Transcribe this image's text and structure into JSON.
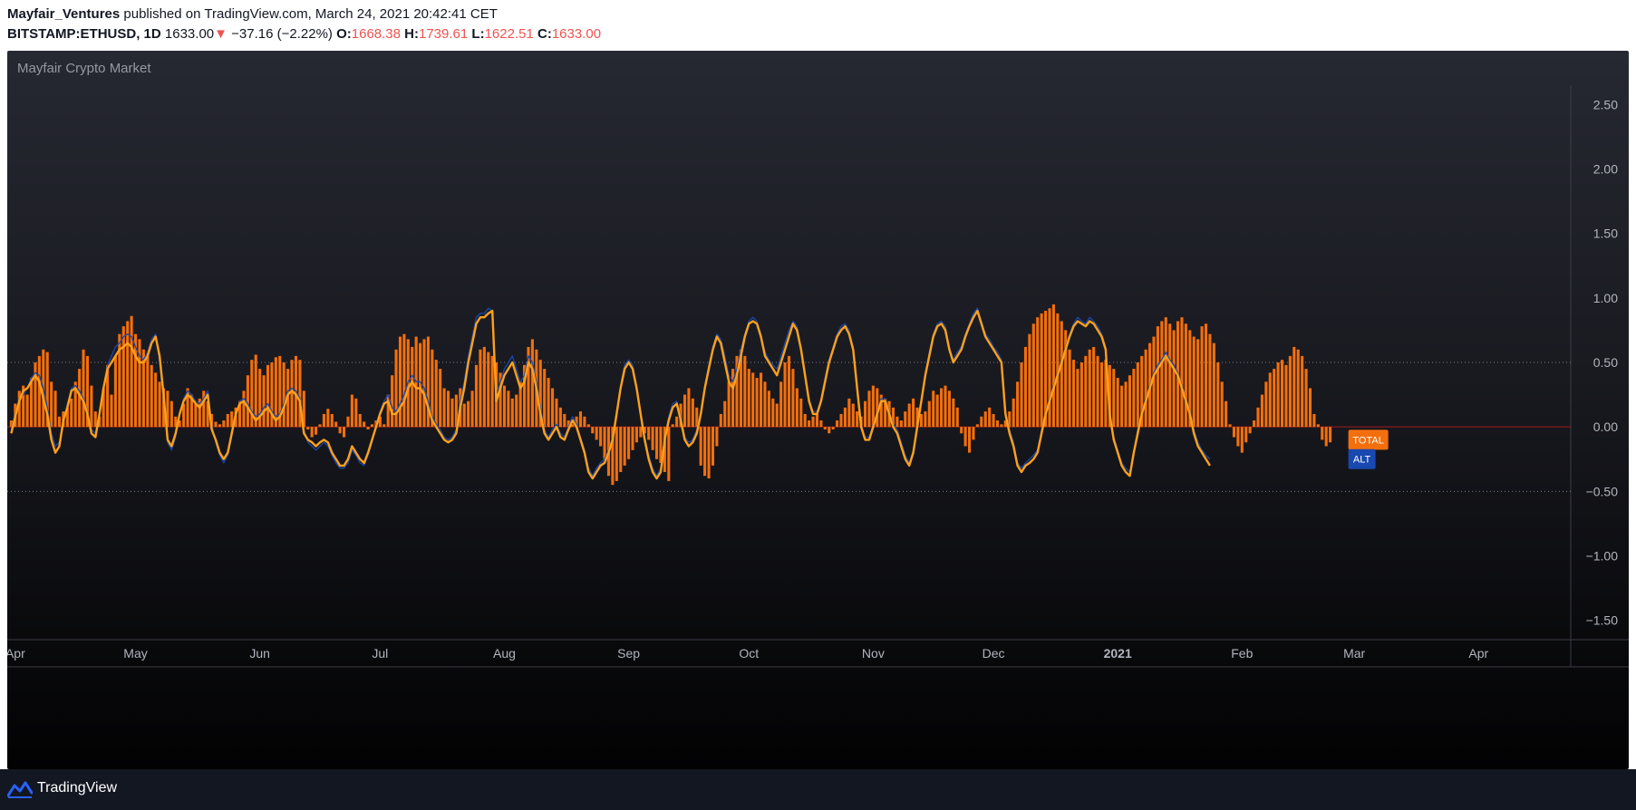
{
  "header": {
    "author": "Mayfair_Ventures",
    "published_text": " published on TradingView.com, March 24, 2021 20:42:41 CET",
    "symbol": "BITSTAMP:ETHUSD",
    "interval": ", 1D",
    "price": "1633.00",
    "change_arrow": "▼",
    "change": "−37.16 (−2.22%)",
    "open_label": "O:",
    "open": "1668.38",
    "high_label": "H:",
    "high": "1739.61",
    "low_label": "L:",
    "low": "1622.51",
    "close_label": "C:",
    "close": "1633.00"
  },
  "footer": {
    "brand": "TradingView"
  },
  "colors": {
    "histogram": "#f46f0c",
    "orange_line": "#ffa11a",
    "blue_line": "#1848b0",
    "gray_line": "#9598a1",
    "zero_line": "#a31c1c",
    "text_red": "#ef5350"
  },
  "chart_data": {
    "type": "bar",
    "title": "Mayfair Crypto Market",
    "y_ticks": [
      "2.50",
      "2.00",
      "1.50",
      "1.00",
      "0.50",
      "0.00",
      "−0.50",
      "−1.00",
      "−1.50"
    ],
    "ylim": [
      -1.65,
      2.65
    ],
    "reference_lines": [
      0.5,
      -0.5
    ],
    "x_ticks": [
      {
        "label": "Apr",
        "date": "2020-04-01"
      },
      {
        "label": "May",
        "date": "2020-05-01"
      },
      {
        "label": "Jun",
        "date": "2020-06-01"
      },
      {
        "label": "Jul",
        "date": "2020-07-01"
      },
      {
        "label": "Aug",
        "date": "2020-08-01"
      },
      {
        "label": "Sep",
        "date": "2020-09-01"
      },
      {
        "label": "Oct",
        "date": "2020-10-01"
      },
      {
        "label": "Nov",
        "date": "2020-11-01"
      },
      {
        "label": "Dec",
        "date": "2020-12-01"
      },
      {
        "label": "2021",
        "date": "2021-01-01",
        "bold": true
      },
      {
        "label": "Feb",
        "date": "2021-02-01"
      },
      {
        "label": "Mar",
        "date": "2021-03-01"
      },
      {
        "label": "Apr",
        "date": "2021-04-01"
      }
    ],
    "xlim": [
      "2020-03-30",
      "2021-04-24"
    ],
    "series": [
      {
        "type": "histogram",
        "start_date": "2020-03-31",
        "values": [
          0.05,
          0.18,
          0.28,
          0.32,
          0.25,
          0.38,
          0.5,
          0.55,
          0.6,
          0.58,
          0.35,
          0.28,
          0.08,
          0.12,
          0.15,
          0.22,
          0.35,
          0.45,
          0.6,
          0.55,
          0.32,
          0.12,
          0.08,
          0.3,
          0.48,
          0.25,
          0.55,
          0.72,
          0.78,
          0.82,
          0.86,
          0.72,
          0.68,
          0.6,
          0.55,
          0.48,
          0.42,
          0.35,
          0.3,
          0.28,
          0.2,
          0.08,
          0.05,
          0.18,
          0.3,
          0.25,
          0.18,
          0.22,
          0.28,
          0.2,
          0.1,
          0.04,
          0.02,
          0.05,
          0.1,
          0.12,
          0.15,
          0.2,
          0.28,
          0.4,
          0.52,
          0.56,
          0.45,
          0.4,
          0.48,
          0.5,
          0.54,
          0.55,
          0.5,
          0.45,
          0.52,
          0.55,
          0.52,
          0.28,
          -0.02,
          -0.08,
          -0.06,
          0.02,
          0.1,
          0.14,
          0.1,
          0.04,
          -0.05,
          -0.08,
          0.08,
          0.25,
          0.22,
          0.1,
          0.04,
          -0.02,
          0.02,
          0.05,
          0.08,
          0.02,
          0.25,
          0.4,
          0.6,
          0.7,
          0.72,
          0.68,
          0.62,
          0.7,
          0.65,
          0.68,
          0.7,
          0.6,
          0.52,
          0.45,
          0.3,
          0.28,
          0.22,
          0.25,
          0.3,
          0.18,
          0.2,
          0.28,
          0.48,
          0.6,
          0.62,
          0.58,
          0.55,
          0.5,
          0.42,
          0.32,
          0.28,
          0.22,
          0.25,
          0.35,
          0.48,
          0.62,
          0.68,
          0.6,
          0.52,
          0.45,
          0.38,
          0.3,
          0.22,
          0.15,
          0.1,
          0.05,
          0.02,
          0.08,
          0.12,
          0.08,
          0.02,
          -0.05,
          -0.1,
          -0.15,
          -0.25,
          -0.38,
          -0.45,
          -0.42,
          -0.35,
          -0.3,
          -0.25,
          -0.18,
          -0.12,
          -0.08,
          -0.05,
          -0.1,
          -0.18,
          -0.25,
          -0.28,
          -0.35,
          -0.42,
          0.02,
          0.08,
          0.18,
          0.25,
          0.3,
          0.22,
          0.15,
          -0.3,
          -0.38,
          -0.4,
          -0.3,
          -0.15,
          0.1,
          0.2,
          0.35,
          0.45,
          0.55,
          0.6,
          0.55,
          0.45,
          0.42,
          0.38,
          0.42,
          0.35,
          0.28,
          0.22,
          0.18,
          0.35,
          0.5,
          0.55,
          0.45,
          0.3,
          0.22,
          0.1,
          0.05,
          0.08,
          0.1,
          0.05,
          -0.02,
          -0.05,
          -0.02,
          0.05,
          0.1,
          0.15,
          0.22,
          0.18,
          0.12,
          0.08,
          0.2,
          0.28,
          0.32,
          0.3,
          0.25,
          0.22,
          0.2,
          0.15,
          0.08,
          0.05,
          0.12,
          0.18,
          0.22,
          0.15,
          0.1,
          0.12,
          0.2,
          0.28,
          0.25,
          0.3,
          0.32,
          0.28,
          0.22,
          0.15,
          -0.05,
          -0.15,
          -0.2,
          -0.1,
          0.02,
          0.08,
          0.12,
          0.15,
          0.1,
          0.05,
          0.02,
          0.05,
          0.12,
          0.22,
          0.35,
          0.5,
          0.62,
          0.72,
          0.8,
          0.85,
          0.88,
          0.9,
          0.92,
          0.95,
          0.88,
          0.82,
          0.75,
          0.6,
          0.52,
          0.45,
          0.5,
          0.55,
          0.6,
          0.62,
          0.55,
          0.5,
          0.52,
          0.48,
          0.45,
          0.38,
          0.32,
          0.35,
          0.4,
          0.45,
          0.5,
          0.55,
          0.6,
          0.65,
          0.7,
          0.78,
          0.82,
          0.85,
          0.8,
          0.75,
          0.82,
          0.85,
          0.8,
          0.75,
          0.7,
          0.68,
          0.78,
          0.8,
          0.72,
          0.65,
          0.5,
          0.35,
          0.2,
          0.02,
          -0.08,
          -0.15,
          -0.2,
          -0.12,
          -0.05,
          0.05,
          0.15,
          0.25,
          0.35,
          0.42,
          0.45,
          0.5,
          0.52,
          0.48,
          0.55,
          0.62,
          0.6,
          0.55,
          0.45,
          0.3,
          0.1,
          0.02,
          -0.1,
          -0.15,
          -0.12
        ]
      },
      {
        "name": "TOTAL",
        "type": "line",
        "start_date": "2020-03-31",
        "values": [
          -0.05,
          0.08,
          0.2,
          0.28,
          0.3,
          0.35,
          0.4,
          0.35,
          0.22,
          0.1,
          -0.1,
          -0.2,
          -0.15,
          0.05,
          0.15,
          0.28,
          0.3,
          0.25,
          0.2,
          0.1,
          -0.05,
          -0.08,
          0.1,
          0.3,
          0.45,
          0.5,
          0.55,
          0.6,
          0.62,
          0.65,
          0.62,
          0.55,
          0.5,
          0.5,
          0.55,
          0.65,
          0.7,
          0.55,
          0.25,
          -0.1,
          -0.15,
          -0.05,
          0.1,
          0.2,
          0.25,
          0.22,
          0.18,
          0.15,
          0.2,
          0.25,
          -0.02,
          -0.1,
          -0.2,
          -0.25,
          -0.2,
          -0.05,
          0.1,
          0.18,
          0.2,
          0.15,
          0.1,
          0.05,
          0.08,
          0.12,
          0.15,
          0.1,
          0.05,
          0.08,
          0.15,
          0.25,
          0.28,
          0.25,
          0.2,
          -0.05,
          -0.1,
          -0.12,
          -0.15,
          -0.12,
          -0.1,
          -0.12,
          -0.2,
          -0.25,
          -0.3,
          -0.3,
          -0.25,
          -0.15,
          -0.2,
          -0.25,
          -0.28,
          -0.2,
          -0.1,
          0,
          0.1,
          0.18,
          0.2,
          0.1,
          0.1,
          0.15,
          0.2,
          0.3,
          0.35,
          0.3,
          0.3,
          0.25,
          0.15,
          0.05,
          0,
          -0.05,
          -0.1,
          -0.12,
          -0.1,
          -0.05,
          0.15,
          0.3,
          0.5,
          0.65,
          0.8,
          0.85,
          0.85,
          0.88,
          0.9,
          0.2,
          0.3,
          0.4,
          0.45,
          0.5,
          0.4,
          0.3,
          0.35,
          0.5,
          0.45,
          0.3,
          0.1,
          -0.05,
          -0.1,
          -0.05,
          0,
          -0.08,
          -0.1,
          -0.02,
          0.05,
          0,
          -0.1,
          -0.2,
          -0.35,
          -0.4,
          -0.35,
          -0.3,
          -0.28,
          -0.2,
          -0.1,
          0.1,
          0.3,
          0.45,
          0.5,
          0.45,
          0.3,
          0.1,
          -0.1,
          -0.25,
          -0.35,
          -0.4,
          -0.35,
          -0.1,
          0.05,
          0.15,
          0.18,
          0.05,
          -0.1,
          -0.15,
          -0.12,
          -0.05,
          0.1,
          0.3,
          0.45,
          0.6,
          0.7,
          0.65,
          0.5,
          0.35,
          0.3,
          0.4,
          0.55,
          0.7,
          0.8,
          0.82,
          0.8,
          0.7,
          0.55,
          0.5,
          0.45,
          0.4,
          0.5,
          0.6,
          0.7,
          0.8,
          0.75,
          0.6,
          0.4,
          0.2,
          0.1,
          0.1,
          0.2,
          0.35,
          0.5,
          0.6,
          0.7,
          0.75,
          0.78,
          0.72,
          0.6,
          0.3,
          0,
          -0.1,
          -0.1,
          0,
          0.1,
          0.2,
          0.2,
          0.1,
          0,
          -0.05,
          -0.15,
          -0.25,
          -0.3,
          -0.2,
          0,
          0.2,
          0.4,
          0.55,
          0.7,
          0.78,
          0.8,
          0.75,
          0.6,
          0.5,
          0.55,
          0.6,
          0.7,
          0.78,
          0.85,
          0.9,
          0.8,
          0.7,
          0.65,
          0.6,
          0.55,
          0.5,
          0.1,
          -0.05,
          -0.15,
          -0.3,
          -0.35,
          -0.3,
          -0.28,
          -0.25,
          -0.2,
          -0.05,
          0.1,
          0.2,
          0.3,
          0.4,
          0.5,
          0.6,
          0.7,
          0.78,
          0.82,
          0.8,
          0.78,
          0.82,
          0.8,
          0.75,
          0.7,
          0.6,
          0.1,
          -0.1,
          -0.2,
          -0.3,
          -0.35,
          -0.38,
          -0.2,
          -0.05,
          0.1,
          0.2,
          0.3,
          0.4,
          0.45,
          0.5,
          0.55,
          0.5,
          0.45,
          0.4,
          0.3,
          0.2,
          0.1,
          -0.05,
          -0.15,
          -0.2,
          -0.25,
          -0.3
        ]
      },
      {
        "name": "ALT",
        "type": "line",
        "start_date": "2020-03-31",
        "values": [
          -0.02,
          0.1,
          0.22,
          0.25,
          0.3,
          0.38,
          0.42,
          0.4,
          0.3,
          0.15,
          -0.05,
          -0.15,
          -0.12,
          0.05,
          0.18,
          0.3,
          0.32,
          0.28,
          0.22,
          0.12,
          -0.02,
          -0.05,
          0.12,
          0.32,
          0.48,
          0.55,
          0.62,
          0.65,
          0.7,
          0.72,
          0.7,
          0.62,
          0.55,
          0.52,
          0.58,
          0.68,
          0.72,
          0.5,
          0.2,
          -0.12,
          -0.18,
          -0.08,
          0.1,
          0.22,
          0.28,
          0.25,
          0.2,
          0.18,
          0.22,
          0.28,
          0.02,
          -0.12,
          -0.22,
          -0.28,
          -0.22,
          -0.08,
          0.08,
          0.2,
          0.22,
          0.18,
          0.12,
          0.08,
          0.1,
          0.15,
          0.18,
          0.12,
          0.08,
          0.1,
          0.18,
          0.28,
          0.3,
          0.28,
          0.22,
          -0.02,
          -0.12,
          -0.15,
          -0.18,
          -0.15,
          -0.12,
          -0.15,
          -0.22,
          -0.28,
          -0.32,
          -0.32,
          -0.28,
          -0.18,
          -0.22,
          -0.28,
          -0.3,
          -0.22,
          -0.12,
          0.02,
          0.12,
          0.2,
          0.25,
          0.15,
          0.12,
          0.18,
          0.25,
          0.35,
          0.4,
          0.35,
          0.35,
          0.3,
          0.2,
          0.08,
          0.02,
          -0.02,
          -0.08,
          -0.1,
          -0.08,
          -0.02,
          0.2,
          0.35,
          0.55,
          0.7,
          0.85,
          0.88,
          0.88,
          0.92,
          0.9,
          0.25,
          0.35,
          0.45,
          0.5,
          0.55,
          0.45,
          0.35,
          0.4,
          0.55,
          0.5,
          0.35,
          0.15,
          -0.02,
          -0.08,
          -0.02,
          0.02,
          -0.05,
          -0.08,
          0,
          0.08,
          0.02,
          -0.08,
          -0.18,
          -0.32,
          -0.38,
          -0.32,
          -0.28,
          -0.25,
          -0.18,
          -0.08,
          0.12,
          0.32,
          0.48,
          0.52,
          0.48,
          0.32,
          0.12,
          -0.08,
          -0.22,
          -0.32,
          -0.38,
          -0.32,
          -0.08,
          0.08,
          0.18,
          0.2,
          0.08,
          -0.08,
          -0.12,
          -0.1,
          -0.02,
          0.12,
          0.32,
          0.48,
          0.62,
          0.72,
          0.68,
          0.55,
          0.4,
          0.35,
          0.45,
          0.6,
          0.72,
          0.82,
          0.85,
          0.82,
          0.72,
          0.58,
          0.52,
          0.48,
          0.45,
          0.55,
          0.65,
          0.75,
          0.82,
          0.78,
          0.62,
          0.42,
          0.22,
          0.12,
          0.12,
          0.22,
          0.38,
          0.52,
          0.62,
          0.72,
          0.78,
          0.8,
          0.75,
          0.62,
          0.32,
          0.02,
          -0.08,
          -0.08,
          0.02,
          0.12,
          0.22,
          0.22,
          0.12,
          0.02,
          -0.02,
          -0.12,
          -0.22,
          -0.28,
          -0.18,
          0.02,
          0.22,
          0.42,
          0.58,
          0.72,
          0.8,
          0.82,
          0.78,
          0.62,
          0.52,
          0.58,
          0.62,
          0.72,
          0.8,
          0.88,
          0.92,
          0.82,
          0.72,
          0.68,
          0.62,
          0.58,
          0.52,
          0.12,
          -0.02,
          -0.12,
          -0.28,
          -0.32,
          -0.28,
          -0.25,
          -0.22,
          -0.18,
          -0.02,
          0.12,
          0.22,
          0.32,
          0.42,
          0.52,
          0.62,
          0.72,
          0.8,
          0.85,
          0.82,
          0.8,
          0.85,
          0.82,
          0.78,
          0.72,
          0.62,
          0.12,
          -0.08,
          -0.18,
          -0.28,
          -0.32,
          -0.35,
          -0.18,
          -0.02,
          0.12,
          0.22,
          0.32,
          0.42,
          0.48,
          0.52,
          0.58,
          0.52,
          0.48,
          0.42,
          0.32,
          0.22,
          0.12,
          -0.02,
          -0.12,
          -0.18,
          -0.22,
          -0.25
        ]
      }
    ],
    "labels": [
      {
        "text": "TOTAL",
        "value": -0.1
      },
      {
        "text": "ALT",
        "value": -0.25
      }
    ]
  }
}
